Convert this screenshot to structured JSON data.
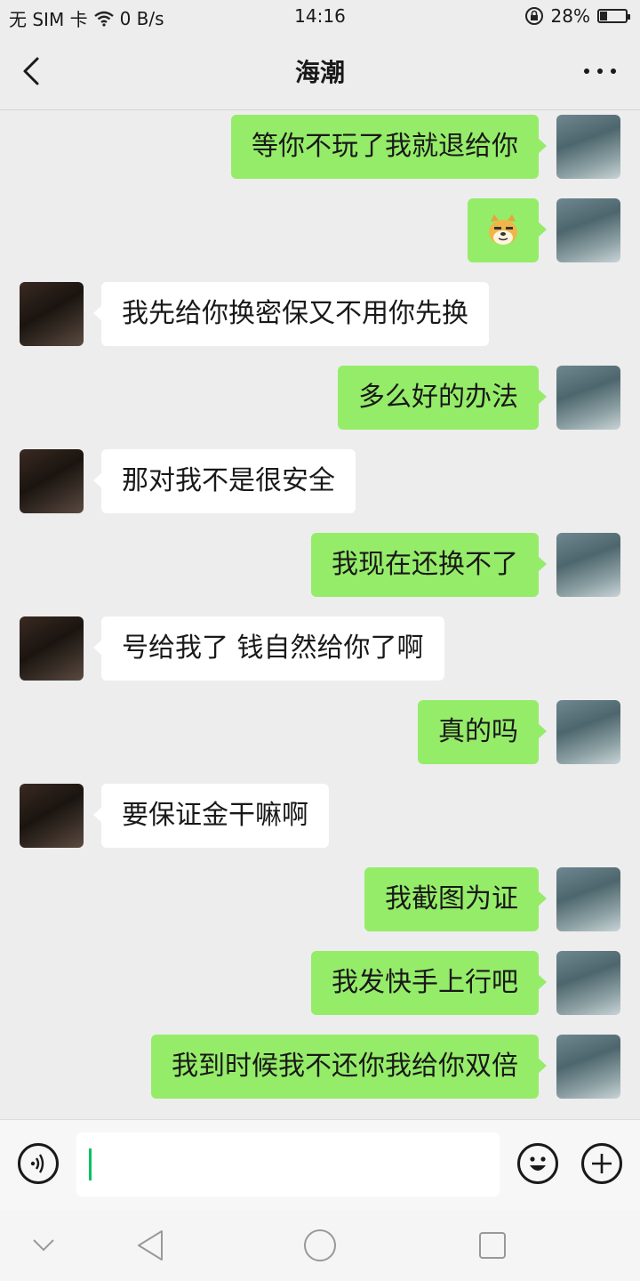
{
  "status_bar": {
    "carrier": "无 SIM 卡",
    "speed": "0 B/s",
    "time": "14:16",
    "battery": "28%",
    "battery_level": 0.28
  },
  "header": {
    "title": "海潮"
  },
  "messages": [
    {
      "from": "me",
      "text": "等你不玩了我就退给你"
    },
    {
      "from": "me",
      "sticker": "doge-face-icon"
    },
    {
      "from": "them",
      "text": "我先给你换密保又不用你先换"
    },
    {
      "from": "me",
      "text": "多么好的办法"
    },
    {
      "from": "them",
      "text": "那对我不是很安全"
    },
    {
      "from": "me",
      "text": "我现在还换不了"
    },
    {
      "from": "them",
      "text": "号给我了 钱自然给你了啊"
    },
    {
      "from": "me",
      "text": "真的吗"
    },
    {
      "from": "them",
      "text": "要保证金干嘛啊"
    },
    {
      "from": "me",
      "text": "我截图为证"
    },
    {
      "from": "me",
      "text": "我发快手上行吧"
    },
    {
      "from": "me",
      "text": "我到时候我不还你我给你双倍"
    }
  ],
  "colors": {
    "my_bubble": "#95ec69",
    "their_bubble": "#ffffff",
    "background": "#ededed",
    "cursor": "#07c160"
  }
}
